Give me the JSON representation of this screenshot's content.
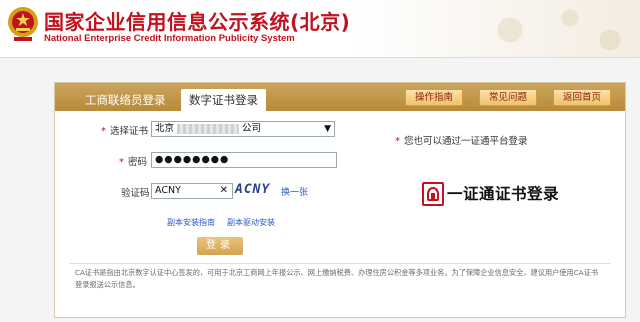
{
  "header": {
    "title_cn": "国家企业信用信息公示系统(北京)",
    "title_en": "National Enterprise Credit Information Publicity System"
  },
  "tabs": {
    "staff_login": "工商联络员登录",
    "cert_login": "数字证书登录"
  },
  "top_buttons": {
    "guide": "操作指南",
    "faq": "常见问题",
    "home": "返回首页"
  },
  "form": {
    "cert_label": "选择证书",
    "cert_value_prefix": "北京",
    "cert_value_suffix": "公司",
    "password_label": "密码",
    "password_value": "●●●●●●●●",
    "captcha_label": "验证码",
    "captcha_value": "ACNY",
    "captcha_image_text": "ACNY",
    "refresh_link": "换一张",
    "install_guide_link": "副本安装指南",
    "driver_install_link": "副本驱动安装",
    "login_button": "登录"
  },
  "right": {
    "hint": "您也可以通过一证通平台登录",
    "logo_text": "一证通证书登录"
  },
  "note": "CA证书是指由北京数字认证中心签发的，可用于北京工商网上年报公示、网上缴纳税费、办理住房公积金等多项业务。为了保障企业信息安全，建议用户使用CA证书登录报送公示信息。",
  "colors": {
    "brand_red": "#c1121f",
    "tab_gold": "#b88a3a",
    "link_blue": "#2a55c5"
  }
}
